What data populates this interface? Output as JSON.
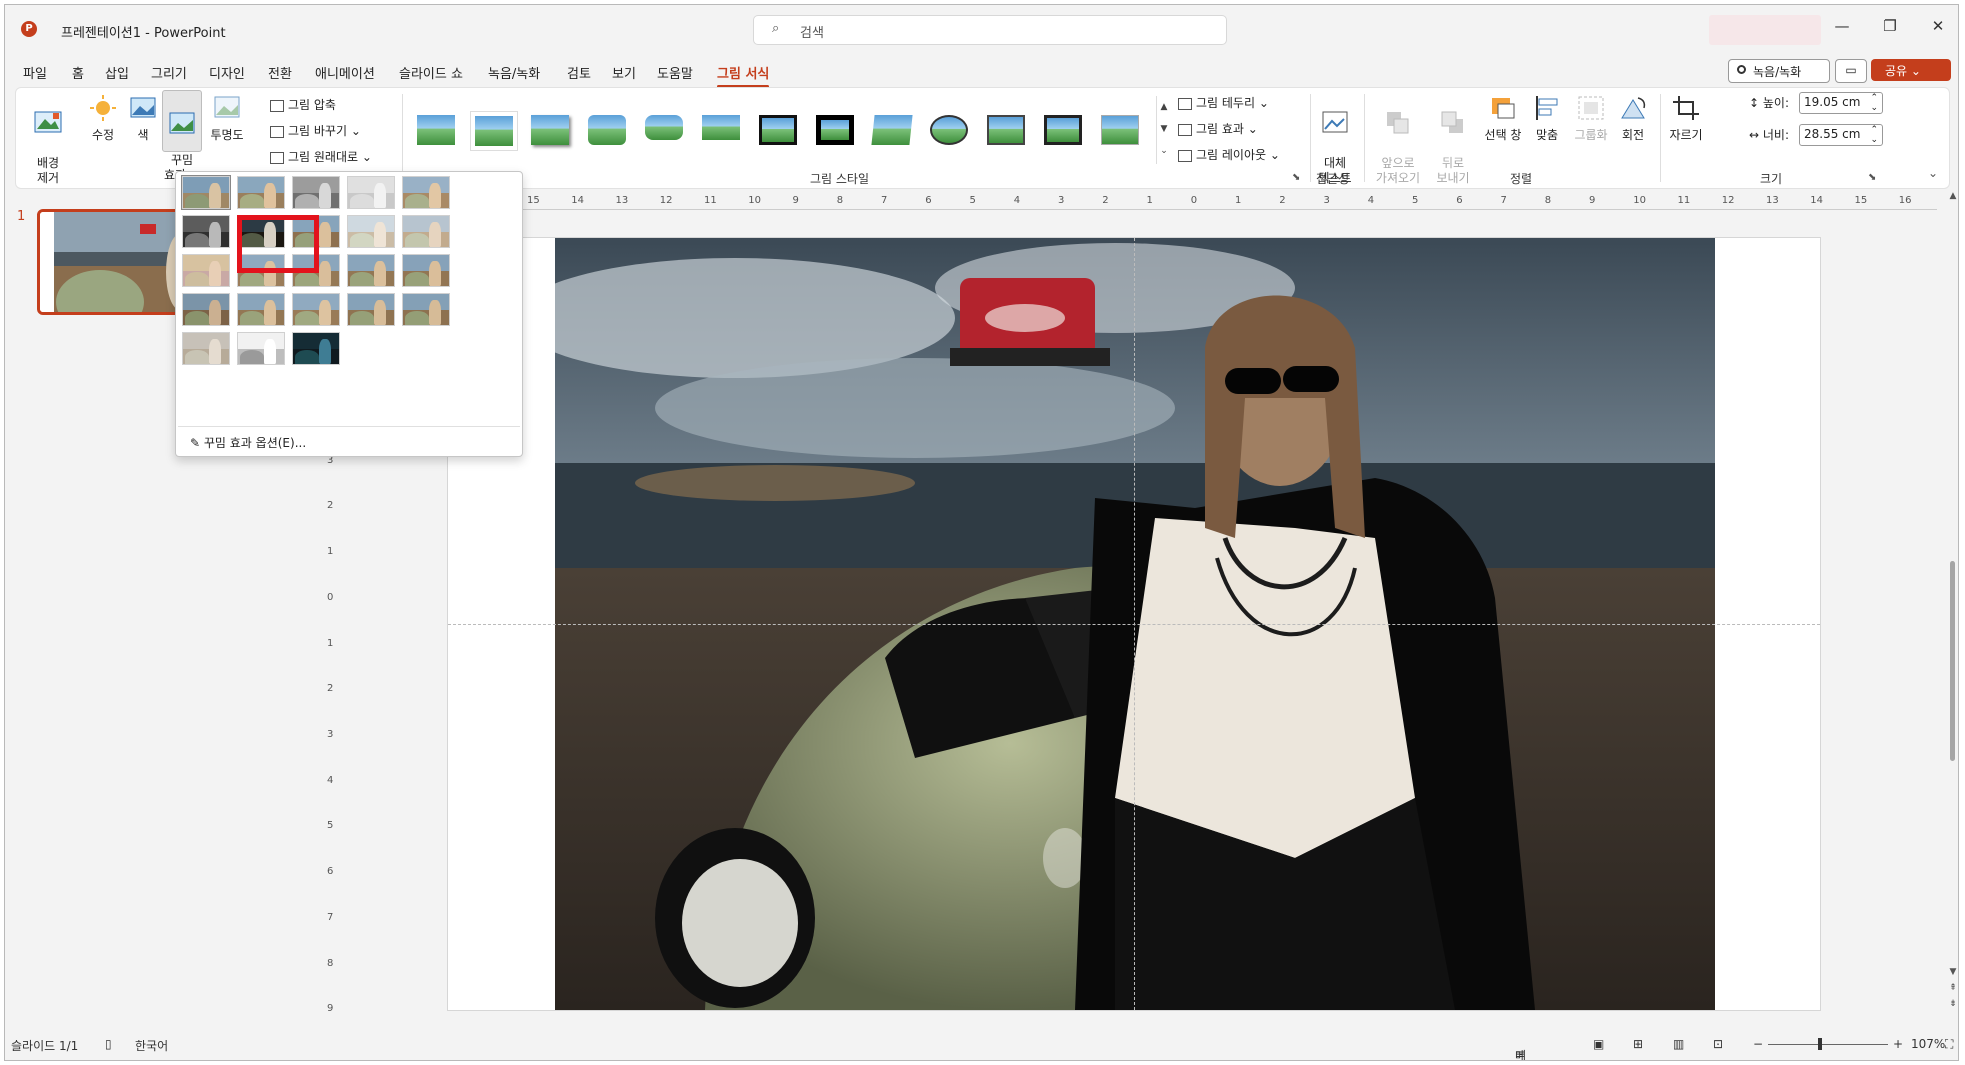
{
  "titlebar": {
    "app_logo": "P",
    "doc_title": "프레젠테이션1  -  PowerPoint",
    "search_placeholder": "검색",
    "minimize": "—",
    "restore": "❐",
    "close": "✕"
  },
  "menu": {
    "tabs": [
      "파일",
      "홈",
      "삽입",
      "그리기",
      "디자인",
      "전환",
      "애니메이션",
      "슬라이드 쇼",
      "녹음/녹화",
      "검토",
      "보기",
      "도움말",
      "그림 서식"
    ],
    "active_tab": "그림 서식",
    "record_label": "녹음/녹화",
    "comment_icon": "comment-icon",
    "share_label": "공유 ⌄"
  },
  "ribbon": {
    "remove_bg": "배경\n제거",
    "corrections": "수정",
    "color": "색",
    "artistic": "꾸밈\n효과 ⌄",
    "transparency": "투명도",
    "compress": "그림 압축",
    "change": "그림 바꾸기 ⌄",
    "reset": "그림 원래대로",
    "styles_group": "그림 스타일",
    "border": "그림 테두리 ⌄",
    "effects": "그림 효과 ⌄",
    "layout": "그림 레이아웃 ⌄",
    "alt_text": "대체\n텍스트",
    "accessibility_group": "접근성",
    "bring_forward": "앞으로\n가져오기 ⌄",
    "send_backward": "뒤로\n보내기 ⌄",
    "selection_pane": "선택 창",
    "align": "맞춤",
    "group": "그룹화",
    "rotate": "회전",
    "arrange_group": "정렬",
    "crop": "자르기",
    "height_label": "높이:",
    "height_value": "19.05 cm",
    "width_label": "너비:",
    "width_value": "28.55 cm",
    "size_group": "크기"
  },
  "dropdown": {
    "option_label": "꾸밈 효과 옵션(E)..."
  },
  "thumbs": {
    "slide_number": "1"
  },
  "ruler": {
    "h_ticks": [
      "15",
      "14",
      "13",
      "12",
      "11",
      "10",
      "9",
      "8",
      "7",
      "6",
      "5",
      "4",
      "3",
      "2",
      "1",
      "0",
      "1",
      "2",
      "3",
      "4",
      "5",
      "6",
      "7",
      "8",
      "9",
      "10",
      "11",
      "12",
      "13",
      "14",
      "15",
      "16"
    ],
    "v_ticks": [
      "4",
      "3",
      "2",
      "1",
      "0",
      "1",
      "2",
      "3",
      "4",
      "5",
      "6",
      "7",
      "8",
      "9"
    ]
  },
  "status": {
    "slide_info": "슬라이드 1/1",
    "language": "한국어",
    "notes": "메모",
    "zoom": "107%",
    "zoom_minus": "−",
    "zoom_plus": "+",
    "zoom_fraction": 0.42
  },
  "colors": {
    "accent": "#c43e1c",
    "highlight_box": "#e3131c"
  }
}
